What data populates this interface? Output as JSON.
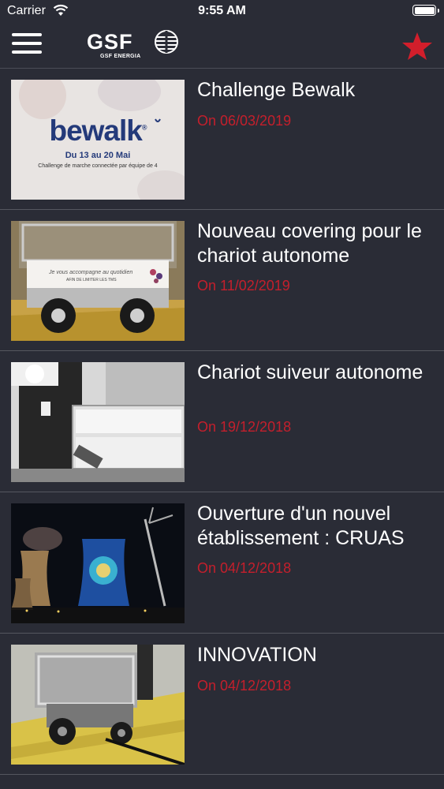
{
  "status_bar": {
    "carrier": "Carrier",
    "time": "9:55 AM"
  },
  "navbar": {
    "logo_text": "GSF",
    "logo_subtitle": "GSF ENERGIA",
    "menu_icon": "hamburger-menu-icon",
    "favorite_icon": "star-icon"
  },
  "colors": {
    "background": "#2a2c36",
    "date": "#c41f2c",
    "star": "#d21e2b"
  },
  "news": [
    {
      "title": "Challenge Bewalk",
      "date": "On 06/03/2019",
      "image": {
        "title": "bewalk",
        "title_mark": "®",
        "line1": "Du 13 au 20 Mai",
        "line2": "Challenge de marche connectée par équipe de 4"
      }
    },
    {
      "title": "Nouveau covering pour le chariot autonome",
      "date": "On 11/02/2019",
      "image": {
        "line1": "Je vous accompagne au quotidien",
        "line2": "AFIN DE LIMITER LES TMS"
      }
    },
    {
      "title": " Chariot suiveur autonome",
      "date": "On 19/12/2018"
    },
    {
      "title": "Ouverture d'un nouvel établissement : CRUAS",
      "date": "On 04/12/2018"
    },
    {
      "title": "INNOVATION",
      "date": "On 04/12/2018"
    }
  ]
}
